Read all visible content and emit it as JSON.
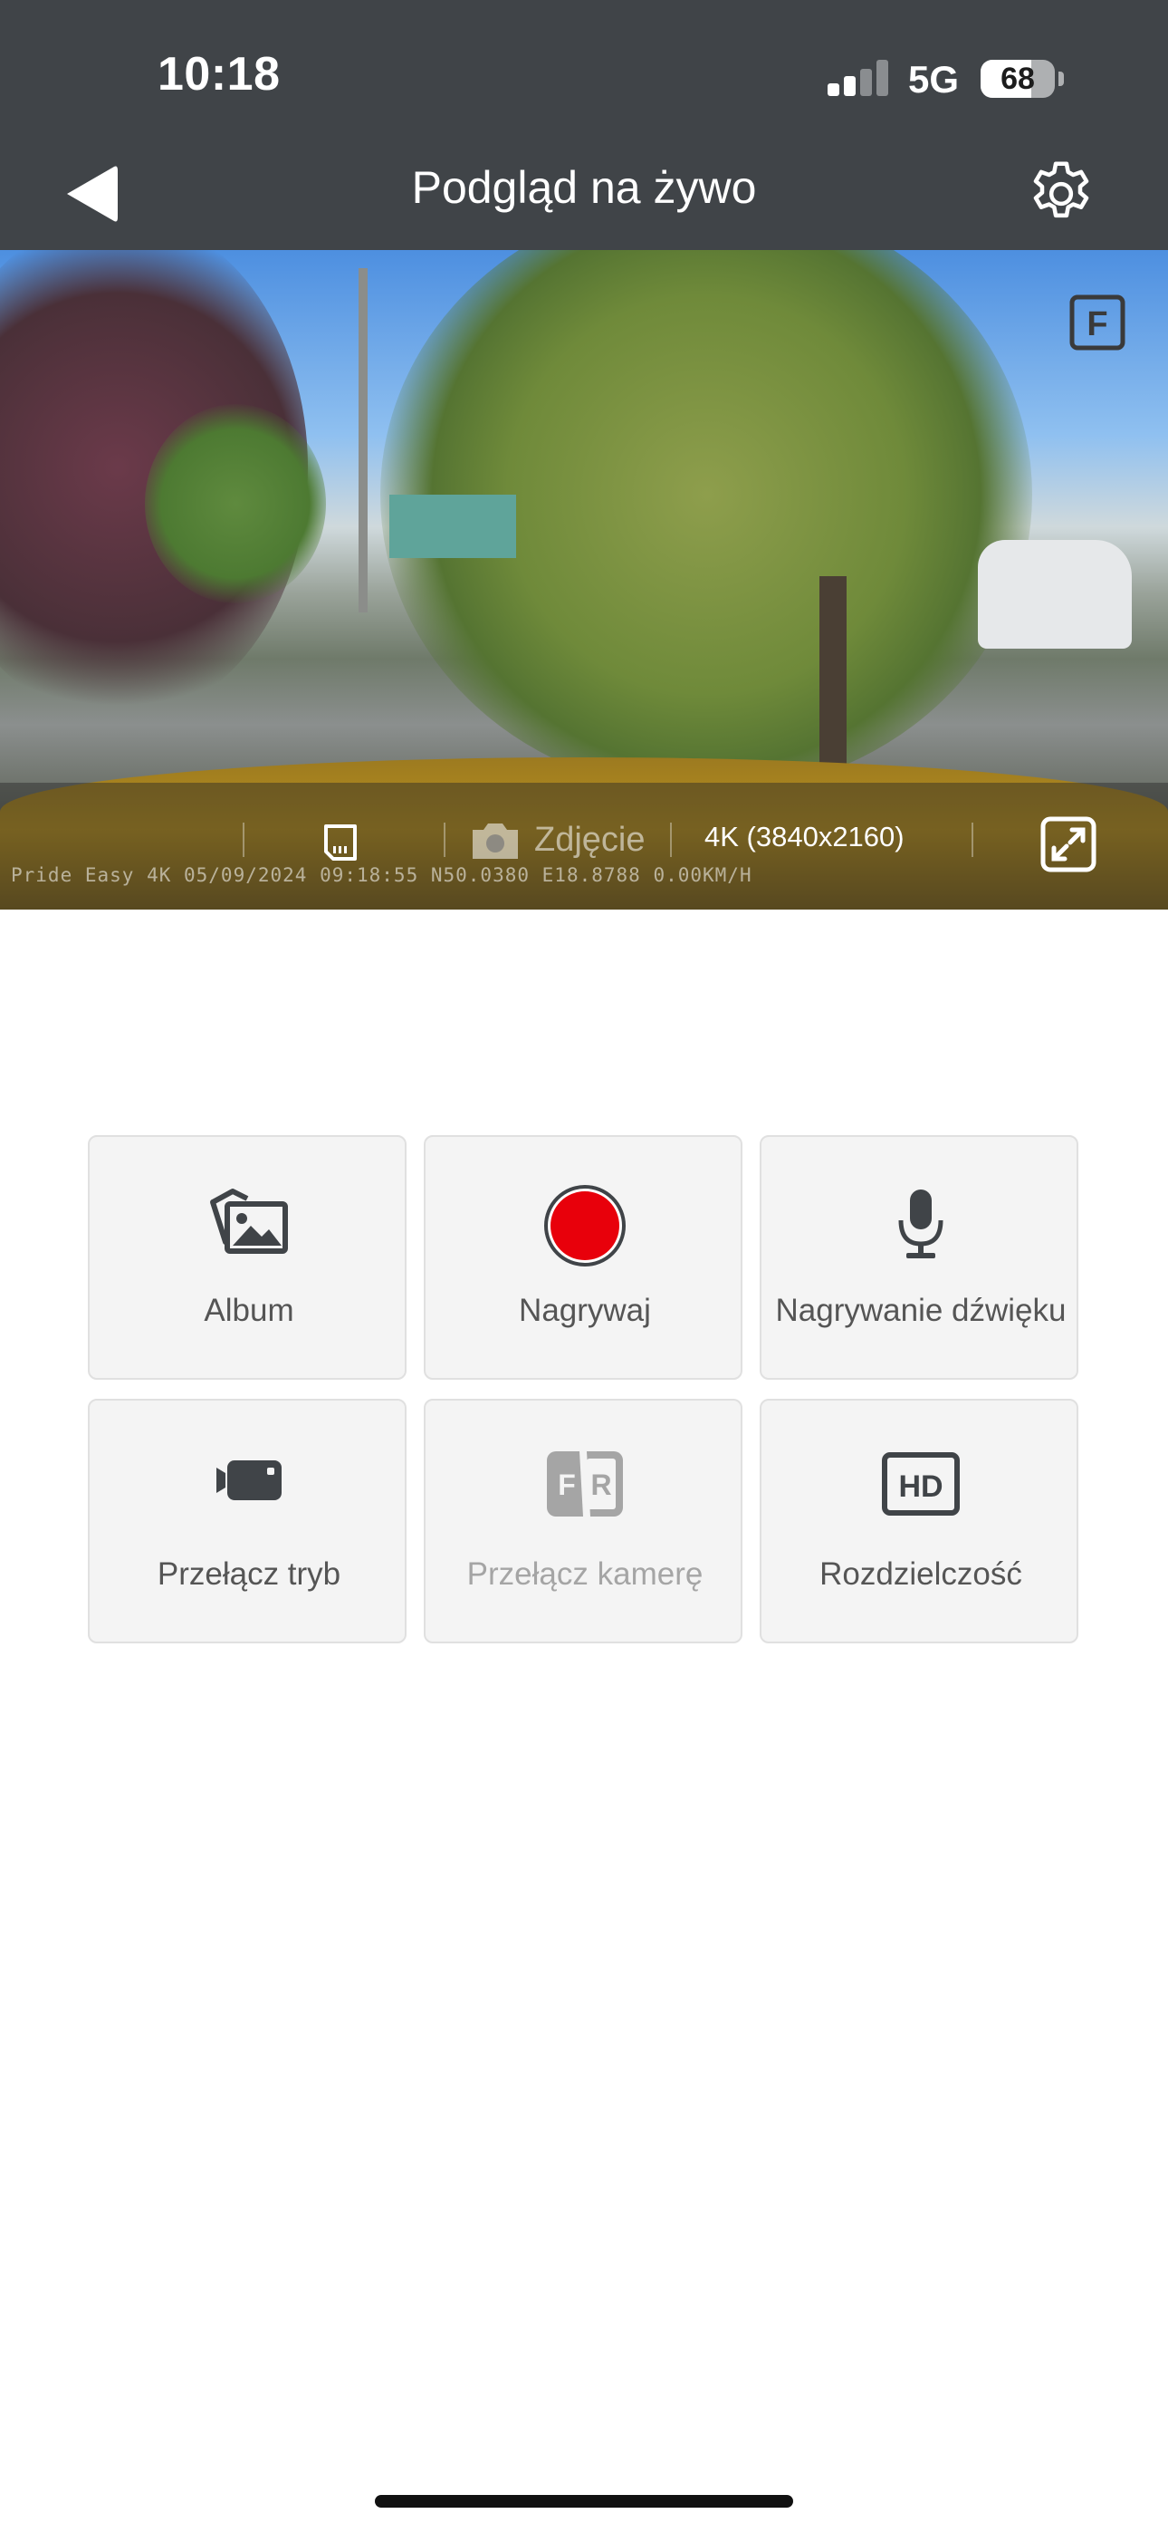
{
  "status_bar": {
    "time": "10:18",
    "network": "5G",
    "battery_percent": "68",
    "battery_level": 0.68,
    "signal_bars_active": 2,
    "signal_bars_total": 4
  },
  "nav": {
    "title": "Podgląd na żywo",
    "back_icon": "back-arrow-icon",
    "settings_icon": "gear-icon"
  },
  "preview": {
    "camera_badge": "F",
    "osd_text": "Pride Easy 4K 05/09/2024 09:18:55 N50.0380 E18.8788 0.00KM/H",
    "photo_label": "Zdjęcie",
    "resolution_label": "4K (3840x2160)",
    "icons": [
      "sd-card-icon",
      "camera-icon",
      "fullscreen-icon"
    ]
  },
  "controls": [
    {
      "label": "Album",
      "icon": "album-icon"
    },
    {
      "label": "Nagrywaj",
      "icon": "record-icon"
    },
    {
      "label": "Nagrywanie dźwięku",
      "icon": "microphone-icon"
    },
    {
      "label": "Przełącz tryb",
      "icon": "video-camera-icon"
    },
    {
      "label": "Przełącz kamerę",
      "icon": "front-rear-camera-icon",
      "disabled": true
    },
    {
      "label": "Rozdzielczość",
      "icon": "hd-icon"
    }
  ],
  "colors": {
    "header_bg": "#404448",
    "record_red": "#e8000b",
    "tile_bg": "#f4f4f4",
    "label_text": "#555555",
    "disabled_text": "#a5a5a5"
  }
}
